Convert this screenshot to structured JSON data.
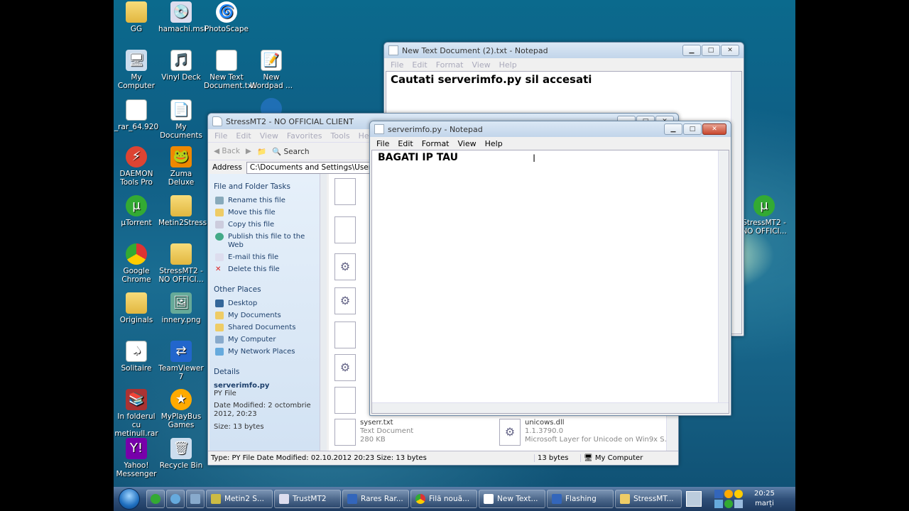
{
  "desktop_icons": {
    "gg": "GG",
    "hamachi": "hamachi.msi",
    "photoscape": "PhotoScape",
    "my_computer": "My Computer",
    "vinyl_deck": "Vinyl Deck",
    "new_text_doc": "New Text Document.txt",
    "new_wordpad": "New Wordpad ...",
    "rar": "_rar_64.920",
    "my_documents": "My Documents",
    "daemon": "DAEMON Tools Pro",
    "zuma": "Zuma Deluxe",
    "utorrent": "µTorrent",
    "metin2stress": "Metin2Stress",
    "chrome": "Google Chrome",
    "stressmt2": "StressMT2 - NO OFFICI...",
    "originals": "Originals",
    "innery": "innery.png",
    "solitaire": "Solitaire",
    "teamviewer": "TeamViewer 7",
    "infolder": "In folderul cu metinull.rar",
    "myplaybus": "MyPlayBus Games",
    "yahoo": "Yahoo! Messenger",
    "recycle": "Recycle Bin",
    "stressmt2_right": "StressMT2 - NO OFFICI..."
  },
  "notepad_back": {
    "title": "New Text Document (2).txt - Notepad",
    "menu": [
      "File",
      "Edit",
      "Format",
      "View",
      "Help"
    ],
    "content": "Cautati serverimfo.py sil accesati"
  },
  "explorer": {
    "title": "StressMT2 - NO OFFICIAL CLIENT",
    "menu": [
      "File",
      "Edit",
      "View",
      "Favorites",
      "Tools",
      "Help"
    ],
    "back": "Back",
    "search": "Search",
    "address_label": "Address",
    "address_value": "C:\\Documents and Settings\\UserXP\\D",
    "file_tasks_heading": "File and Folder Tasks",
    "tasks": [
      "Rename this file",
      "Move this file",
      "Copy this file",
      "Publish this file to the Web",
      "E-mail this file",
      "Delete this file"
    ],
    "other_places_heading": "Other Places",
    "places": [
      "Desktop",
      "My Documents",
      "Shared Documents",
      "My Computer",
      "My Network Places"
    ],
    "details_heading": "Details",
    "details_name": "serverimfo.py",
    "details_type": "PY File",
    "details_modified": "Date Modified: 2 octombrie 2012, 20:23",
    "details_size": "Size: 13 bytes",
    "files": [
      {
        "name": "syserr.txt",
        "type": "Text Document",
        "size": "280 KB"
      },
      {
        "name": "unicows.dll",
        "type": "1.1.3790.0",
        "size": "Microsoft Layer for Unicode on Win9x S..."
      }
    ],
    "status_type": "Type: PY File Date Modified: 02.10.2012 20:23 Size: 13 bytes",
    "status_size": "13 bytes",
    "status_location": "My Computer"
  },
  "notepad_front": {
    "title": "serverimfo.py - Notepad",
    "menu": [
      "File",
      "Edit",
      "Format",
      "View",
      "Help"
    ],
    "content": "BAGATI IP TAU"
  },
  "taskbar": {
    "items": [
      "Metin2 S...",
      "TrustMT2",
      "Rares Rar...",
      "Filă nouă...",
      "New Text...",
      "Flashing",
      "StressMT..."
    ],
    "time": "20:25",
    "day": "marți"
  }
}
